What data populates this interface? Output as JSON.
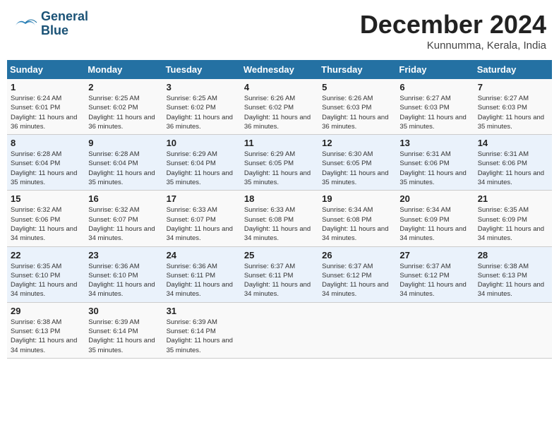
{
  "header": {
    "logo_line1": "General",
    "logo_line2": "Blue",
    "month": "December 2024",
    "location": "Kunnumma, Kerala, India"
  },
  "weekdays": [
    "Sunday",
    "Monday",
    "Tuesday",
    "Wednesday",
    "Thursday",
    "Friday",
    "Saturday"
  ],
  "weeks": [
    [
      {
        "day": "1",
        "sunrise": "Sunrise: 6:24 AM",
        "sunset": "Sunset: 6:01 PM",
        "daylight": "Daylight: 11 hours and 36 minutes."
      },
      {
        "day": "2",
        "sunrise": "Sunrise: 6:25 AM",
        "sunset": "Sunset: 6:02 PM",
        "daylight": "Daylight: 11 hours and 36 minutes."
      },
      {
        "day": "3",
        "sunrise": "Sunrise: 6:25 AM",
        "sunset": "Sunset: 6:02 PM",
        "daylight": "Daylight: 11 hours and 36 minutes."
      },
      {
        "day": "4",
        "sunrise": "Sunrise: 6:26 AM",
        "sunset": "Sunset: 6:02 PM",
        "daylight": "Daylight: 11 hours and 36 minutes."
      },
      {
        "day": "5",
        "sunrise": "Sunrise: 6:26 AM",
        "sunset": "Sunset: 6:03 PM",
        "daylight": "Daylight: 11 hours and 36 minutes."
      },
      {
        "day": "6",
        "sunrise": "Sunrise: 6:27 AM",
        "sunset": "Sunset: 6:03 PM",
        "daylight": "Daylight: 11 hours and 35 minutes."
      },
      {
        "day": "7",
        "sunrise": "Sunrise: 6:27 AM",
        "sunset": "Sunset: 6:03 PM",
        "daylight": "Daylight: 11 hours and 35 minutes."
      }
    ],
    [
      {
        "day": "8",
        "sunrise": "Sunrise: 6:28 AM",
        "sunset": "Sunset: 6:04 PM",
        "daylight": "Daylight: 11 hours and 35 minutes."
      },
      {
        "day": "9",
        "sunrise": "Sunrise: 6:28 AM",
        "sunset": "Sunset: 6:04 PM",
        "daylight": "Daylight: 11 hours and 35 minutes."
      },
      {
        "day": "10",
        "sunrise": "Sunrise: 6:29 AM",
        "sunset": "Sunset: 6:04 PM",
        "daylight": "Daylight: 11 hours and 35 minutes."
      },
      {
        "day": "11",
        "sunrise": "Sunrise: 6:29 AM",
        "sunset": "Sunset: 6:05 PM",
        "daylight": "Daylight: 11 hours and 35 minutes."
      },
      {
        "day": "12",
        "sunrise": "Sunrise: 6:30 AM",
        "sunset": "Sunset: 6:05 PM",
        "daylight": "Daylight: 11 hours and 35 minutes."
      },
      {
        "day": "13",
        "sunrise": "Sunrise: 6:31 AM",
        "sunset": "Sunset: 6:06 PM",
        "daylight": "Daylight: 11 hours and 35 minutes."
      },
      {
        "day": "14",
        "sunrise": "Sunrise: 6:31 AM",
        "sunset": "Sunset: 6:06 PM",
        "daylight": "Daylight: 11 hours and 34 minutes."
      }
    ],
    [
      {
        "day": "15",
        "sunrise": "Sunrise: 6:32 AM",
        "sunset": "Sunset: 6:06 PM",
        "daylight": "Daylight: 11 hours and 34 minutes."
      },
      {
        "day": "16",
        "sunrise": "Sunrise: 6:32 AM",
        "sunset": "Sunset: 6:07 PM",
        "daylight": "Daylight: 11 hours and 34 minutes."
      },
      {
        "day": "17",
        "sunrise": "Sunrise: 6:33 AM",
        "sunset": "Sunset: 6:07 PM",
        "daylight": "Daylight: 11 hours and 34 minutes."
      },
      {
        "day": "18",
        "sunrise": "Sunrise: 6:33 AM",
        "sunset": "Sunset: 6:08 PM",
        "daylight": "Daylight: 11 hours and 34 minutes."
      },
      {
        "day": "19",
        "sunrise": "Sunrise: 6:34 AM",
        "sunset": "Sunset: 6:08 PM",
        "daylight": "Daylight: 11 hours and 34 minutes."
      },
      {
        "day": "20",
        "sunrise": "Sunrise: 6:34 AM",
        "sunset": "Sunset: 6:09 PM",
        "daylight": "Daylight: 11 hours and 34 minutes."
      },
      {
        "day": "21",
        "sunrise": "Sunrise: 6:35 AM",
        "sunset": "Sunset: 6:09 PM",
        "daylight": "Daylight: 11 hours and 34 minutes."
      }
    ],
    [
      {
        "day": "22",
        "sunrise": "Sunrise: 6:35 AM",
        "sunset": "Sunset: 6:10 PM",
        "daylight": "Daylight: 11 hours and 34 minutes."
      },
      {
        "day": "23",
        "sunrise": "Sunrise: 6:36 AM",
        "sunset": "Sunset: 6:10 PM",
        "daylight": "Daylight: 11 hours and 34 minutes."
      },
      {
        "day": "24",
        "sunrise": "Sunrise: 6:36 AM",
        "sunset": "Sunset: 6:11 PM",
        "daylight": "Daylight: 11 hours and 34 minutes."
      },
      {
        "day": "25",
        "sunrise": "Sunrise: 6:37 AM",
        "sunset": "Sunset: 6:11 PM",
        "daylight": "Daylight: 11 hours and 34 minutes."
      },
      {
        "day": "26",
        "sunrise": "Sunrise: 6:37 AM",
        "sunset": "Sunset: 6:12 PM",
        "daylight": "Daylight: 11 hours and 34 minutes."
      },
      {
        "day": "27",
        "sunrise": "Sunrise: 6:37 AM",
        "sunset": "Sunset: 6:12 PM",
        "daylight": "Daylight: 11 hours and 34 minutes."
      },
      {
        "day": "28",
        "sunrise": "Sunrise: 6:38 AM",
        "sunset": "Sunset: 6:13 PM",
        "daylight": "Daylight: 11 hours and 34 minutes."
      }
    ],
    [
      {
        "day": "29",
        "sunrise": "Sunrise: 6:38 AM",
        "sunset": "Sunset: 6:13 PM",
        "daylight": "Daylight: 11 hours and 34 minutes."
      },
      {
        "day": "30",
        "sunrise": "Sunrise: 6:39 AM",
        "sunset": "Sunset: 6:14 PM",
        "daylight": "Daylight: 11 hours and 35 minutes."
      },
      {
        "day": "31",
        "sunrise": "Sunrise: 6:39 AM",
        "sunset": "Sunset: 6:14 PM",
        "daylight": "Daylight: 11 hours and 35 minutes."
      },
      null,
      null,
      null,
      null
    ]
  ]
}
